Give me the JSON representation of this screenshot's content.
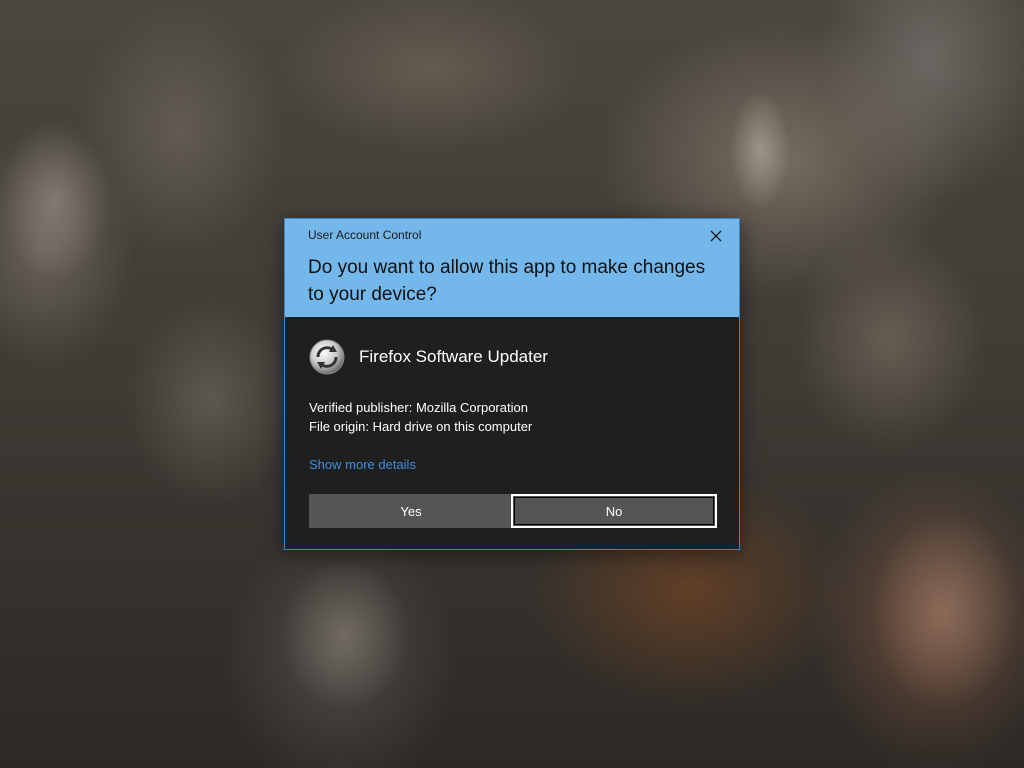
{
  "dialog": {
    "caption": "User Account Control",
    "question": "Do you want to allow this app to make changes to your device?",
    "app_name": "Firefox Software Updater",
    "app_icon": "firefox-updater-icon",
    "publisher_line": "Verified publisher: Mozilla Corporation",
    "origin_line": "File origin: Hard drive on this computer",
    "show_more_label": "Show more details",
    "yes_label": "Yes",
    "no_label": "No",
    "close_icon": "close-icon"
  },
  "colors": {
    "header_bg": "#74b7ea",
    "body_bg": "#1f1f1f",
    "border": "#3c86c8",
    "button_bg": "#555555",
    "link": "#3d8fdd"
  }
}
